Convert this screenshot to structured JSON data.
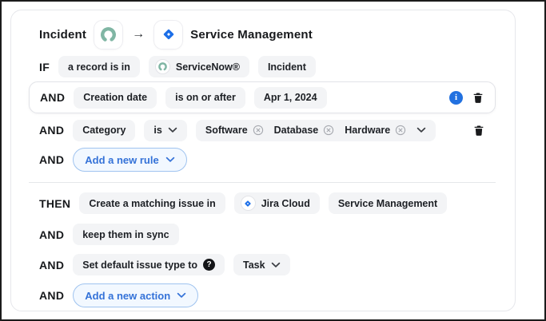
{
  "header": {
    "source_block": "Incident",
    "arrow": "→",
    "target_project": "Service Management"
  },
  "if_section": {
    "if_row": {
      "label": "IF",
      "record_pill": "a record is in",
      "tool_pill": "ServiceNow®",
      "block_pill": "Incident"
    },
    "date_rule": {
      "label": "AND",
      "field": "Creation date",
      "operator": "is on or after",
      "value": "Apr 1, 2024"
    },
    "category_rule": {
      "label": "AND",
      "field": "Category",
      "operator": "is",
      "values": [
        "Software",
        "Database",
        "Hardware"
      ]
    },
    "add_rule": {
      "label": "AND",
      "button_label": "Add a new rule"
    }
  },
  "then_section": {
    "then_row": {
      "label": "THEN",
      "action_pill": "Create a matching issue in",
      "tool_pill": "Jira Cloud",
      "project_pill": "Service Management"
    },
    "sync_row": {
      "label": "AND",
      "text_pill": "keep them in sync"
    },
    "issue_type_row": {
      "label": "AND",
      "text_pill": "Set default issue type to",
      "value_pill": "Task"
    },
    "add_action": {
      "label": "AND",
      "button_label": "Add a new action"
    }
  },
  "icons": {
    "servicenow": "servicenow-ring-logo",
    "jira": "jira-diamond-logo",
    "info": "info-circle",
    "trash": "trash-can",
    "remove": "circle-x",
    "chevron": "chevron-down",
    "help": "question-circle",
    "info_glyph": "i"
  },
  "colors": {
    "accent_blue": "#2271e0",
    "button_blue_text": "#3472d8",
    "button_blue_bg": "#f2f8ff",
    "button_blue_border": "#9fc3ef",
    "servicenow_green": "#80b6a4",
    "jira_blue": "#1d6fe8",
    "pill_bg": "#f3f4f6",
    "text_dark": "#1d2025",
    "border_light": "#e6e7eb"
  }
}
